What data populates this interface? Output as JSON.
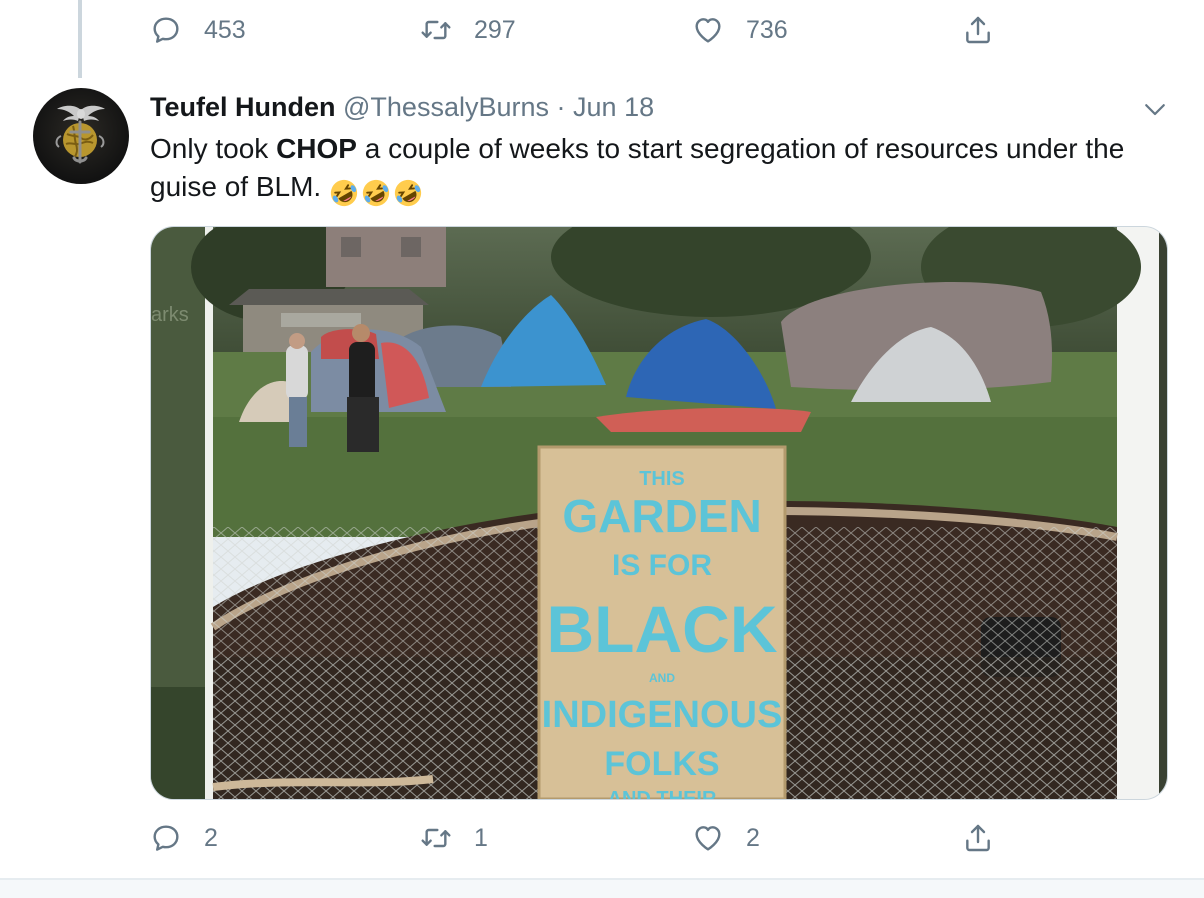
{
  "previous_tweet": {
    "actions": {
      "reply_count": "453",
      "retweet_count": "297",
      "like_count": "736"
    }
  },
  "tweet": {
    "author_name": "Teufel Hunden",
    "author_handle": "@ThessalyBurns",
    "separator": "·",
    "date": "Jun 18",
    "text_before": "Only took ",
    "text_bold": "CHOP",
    "text_after": " a couple of weeks to start segregation of resources under the guise of BLM.",
    "emojis": [
      "rolling-on-floor-laughing",
      "rolling-on-floor-laughing",
      "rolling-on-floor-laughing"
    ],
    "media": {
      "sign_text": [
        "THIS",
        "GARDEN",
        "IS FOR",
        "BLACK",
        "AND",
        "INDIGENOUS",
        "FOLKS",
        "AND THEIR"
      ],
      "left_strip_text": "arks"
    },
    "actions": {
      "reply_count": "2",
      "retweet_count": "1",
      "like_count": "2"
    }
  },
  "colors": {
    "text_primary": "#14171a",
    "text_secondary": "#657786",
    "border": "#ccd6dd"
  }
}
